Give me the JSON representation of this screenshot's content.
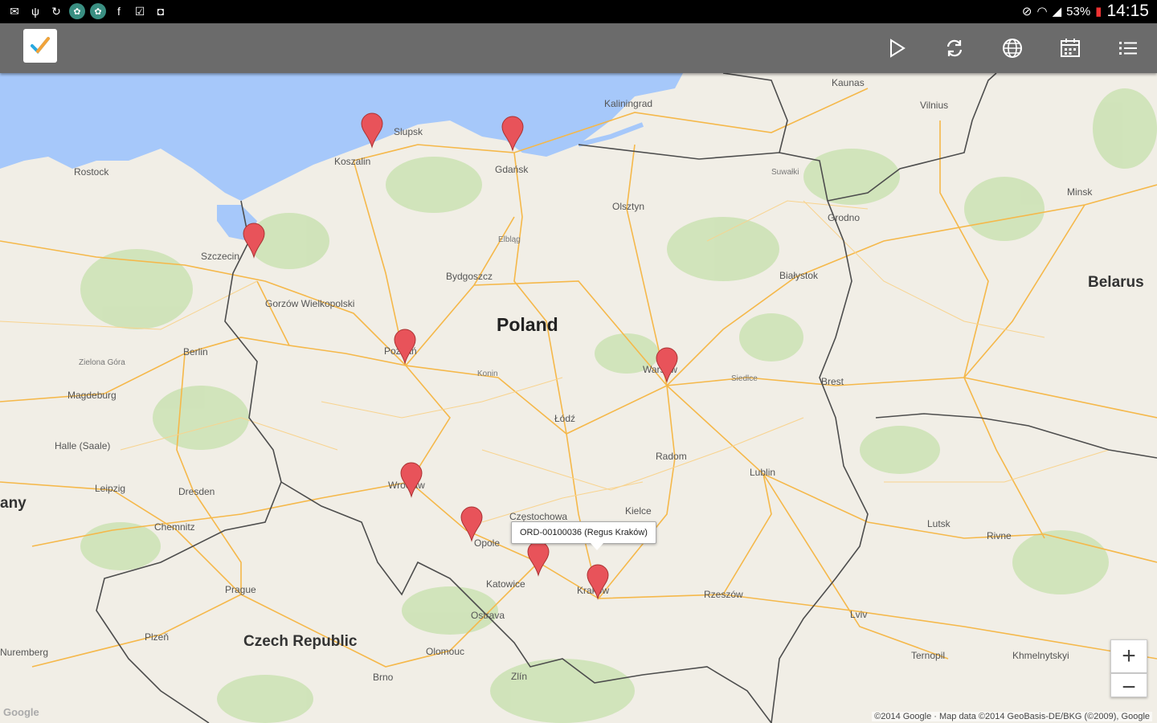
{
  "status_bar": {
    "battery": "53%",
    "time": "14:15"
  },
  "app_bar": {
    "actions": [
      {
        "name": "play-button",
        "icon": "play-icon"
      },
      {
        "name": "sync-button",
        "icon": "sync-icon"
      },
      {
        "name": "globe-button",
        "icon": "globe-icon"
      },
      {
        "name": "calendar-button",
        "icon": "calendar-icon"
      },
      {
        "name": "list-button",
        "icon": "list-icon"
      }
    ]
  },
  "map": {
    "countries": [
      {
        "label": "Poland"
      },
      {
        "label": "Czech Republic"
      },
      {
        "label": "Belarus"
      },
      {
        "label": "any"
      }
    ],
    "cities": [
      "Kaunas",
      "Kaliningrad",
      "Vilnius",
      "Slupsk",
      "Gdańsk",
      "Koszalin",
      "Rostock",
      "Szczecin",
      "Olsztyn",
      "Minsk",
      "Grodno",
      "Bydgoszcz",
      "Białystok",
      "Gorzów Wielkopolski",
      "Berlin",
      "Poznań",
      "Warsaw",
      "Brest",
      "Magdeburg",
      "Łódź",
      "Halle (Saale)",
      "Radom",
      "Lublin",
      "Leipzig",
      "Dresden",
      "Wrocław",
      "Kielce",
      "Częstochowa",
      "Lutsk",
      "Rivne",
      "Chemnitz",
      "Opole",
      "Katowice",
      "Kraków",
      "Prague",
      "Rzeszów",
      "Plzeň",
      "Ostrava",
      "Olomouc",
      "Lviv",
      "Nuremberg",
      "Brno",
      "Zlín",
      "Ternopil",
      "Khmelnytskyi",
      "Elbląg",
      "Suwałki",
      "Siedlce",
      "Konin",
      "Zielona Góra"
    ],
    "info_window": "ORD-00100036 (Regus Kraków)",
    "zoom_in": "+",
    "zoom_out": "−",
    "copyright": "©2014 Google · Map data ©2014 GeoBasis-DE/BKG (©2009), Google",
    "watermark": "Google"
  },
  "colors": {
    "status_bar": "#000000",
    "app_bar": "#6b6b6b",
    "land": "#f1eee6",
    "water": "#a6c8fa",
    "forest": "#cbe2b3",
    "road": "#f5b84a",
    "border": "#4d4d4d",
    "marker": "#e8535a"
  }
}
